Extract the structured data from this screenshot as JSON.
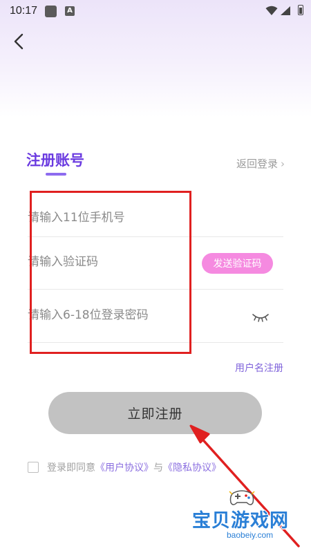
{
  "status_bar": {
    "time": "10:17",
    "notif_icon": "A"
  },
  "header": {
    "title": "注册账号",
    "back_login": "返回登录"
  },
  "form": {
    "phone_placeholder": "请输入11位手机号",
    "code_placeholder": "请输入验证码",
    "send_code_label": "发送验证码",
    "password_placeholder": "请输入6-18位登录密码",
    "username_register": "用户名注册"
  },
  "register_button": "立即注册",
  "agreement": {
    "prefix": "登录即同意",
    "user_agreement": "《用户协议》",
    "and": "与",
    "privacy_policy": "《隐私协议》"
  },
  "watermark": {
    "name": "宝贝游戏网",
    "url": "baobeiy.com"
  },
  "colors": {
    "accent": "#6a3ae0",
    "send_code_bg": "#f58ae0",
    "register_bg": "#c2c2c2",
    "annotation_red": "#e02020"
  },
  "icons": [
    "back-arrow-icon",
    "eye-closed-icon",
    "chevron-right-icon",
    "wifi-icon",
    "signal-icon",
    "battery-icon",
    "gamepad-icon"
  ]
}
